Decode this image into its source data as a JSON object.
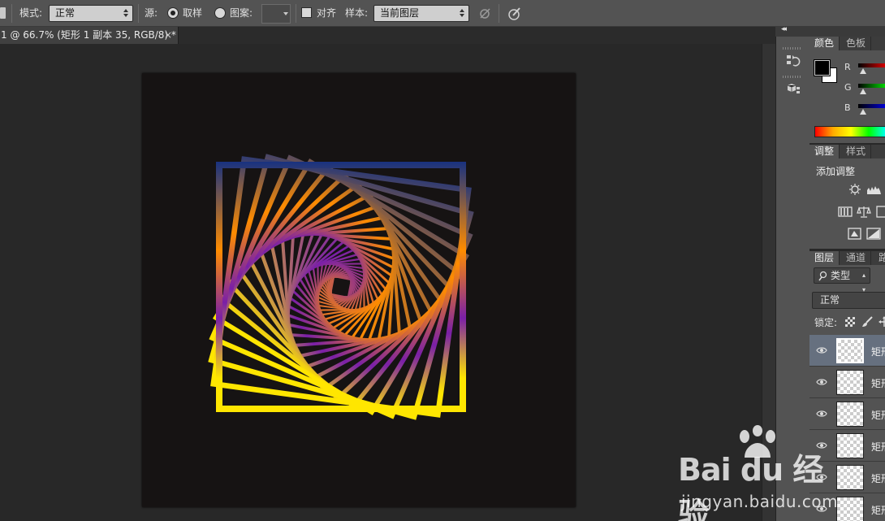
{
  "options_bar": {
    "mode_label": "模式:",
    "mode_value": "正常",
    "source_label": "源:",
    "sampled_label": "取样",
    "pattern_label": "图案:",
    "aligned_label": "对齐",
    "sample_label": "样本:",
    "sample_value": "当前图层",
    "source_selected": "sampled"
  },
  "document_tab": {
    "title": "1 @ 66.7% (矩形 1 副本 35, RGB/8) *",
    "close": "×"
  },
  "dock": {
    "collapse_glyph": "◂◂"
  },
  "color_panel": {
    "tabs": [
      "颜色",
      "色板"
    ],
    "channels": [
      "R",
      "G",
      "B"
    ],
    "foreground": "#000000",
    "background": "#ffffff"
  },
  "adjustments_panel": {
    "tabs": [
      "调整",
      "样式"
    ],
    "title": "添加调整"
  },
  "layers_panel": {
    "tabs": [
      "图层",
      "通道",
      "路"
    ],
    "filter_label": "类型",
    "blend_mode": "正常",
    "lock_label": "锁定:",
    "layers": [
      {
        "name": "矩形",
        "selected": true
      },
      {
        "name": "矩形",
        "selected": false
      },
      {
        "name": "矩形",
        "selected": false
      },
      {
        "name": "矩形",
        "selected": false
      },
      {
        "name": "矩形",
        "selected": false
      },
      {
        "name": "矩形",
        "selected": false
      }
    ]
  },
  "artwork": {
    "colors": [
      "#0c2d87",
      "#ff8c00",
      "#7a1fa8",
      "#ffe600"
    ],
    "outer_frame_colors": [
      "#0c2d87",
      "#ff8c00",
      "#7a1fa8",
      "#ffe600"
    ]
  },
  "watermark": {
    "brand": "Bai du 经验",
    "url": "jingyan.baidu.com"
  }
}
